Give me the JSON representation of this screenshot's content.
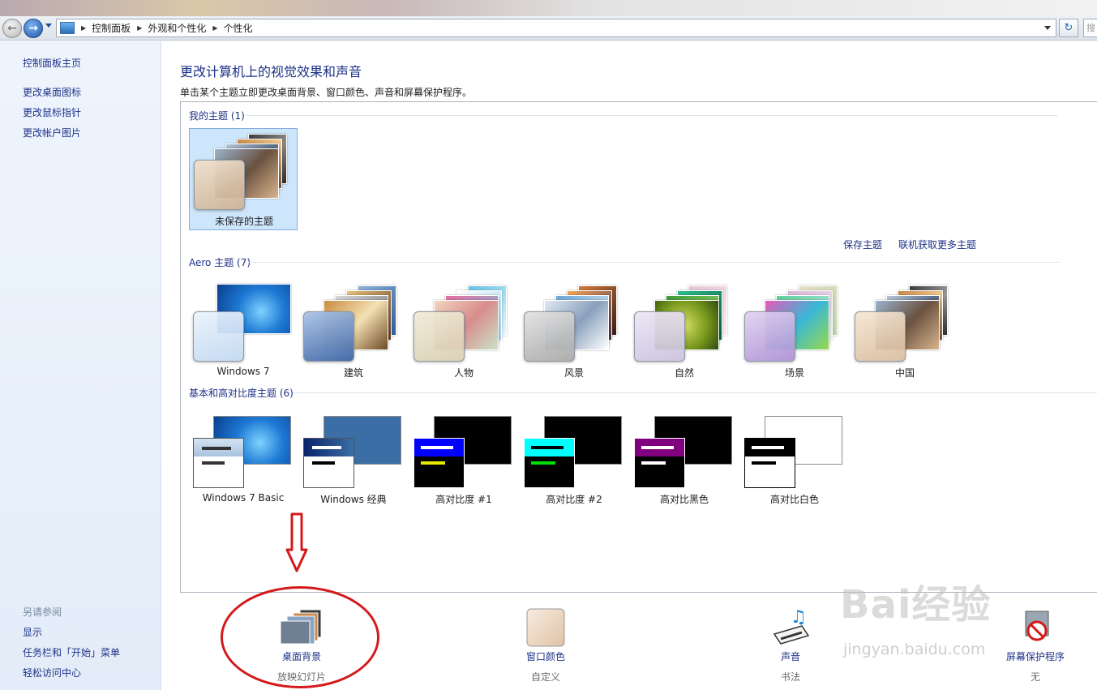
{
  "address_bar": {
    "breadcrumbs": [
      "控制面板",
      "外观和个性化",
      "个性化"
    ],
    "search_placeholder": "搜"
  },
  "sidebar": {
    "home_link": "控制面板主页",
    "links": [
      "更改桌面图标",
      "更改鼠标指针",
      "更改帐户图片"
    ],
    "see_also_heading": "另请参阅",
    "see_also_links": [
      "显示",
      "任务栏和「开始」菜单",
      "轻松访问中心"
    ]
  },
  "main": {
    "title": "更改计算机上的视觉效果和声音",
    "description": "单击某个主题立即更改桌面背景、窗口颜色、声音和屏幕保护程序。",
    "my_themes": {
      "label": "我的主题 (1)",
      "items": [
        {
          "name": "未保存的主题",
          "selected": true
        }
      ]
    },
    "actions": {
      "save_theme": "保存主题",
      "get_more_online": "联机获取更多主题"
    },
    "aero_themes": {
      "label": "Aero 主题 (7)",
      "items": [
        "Windows 7",
        "建筑",
        "人物",
        "风景",
        "自然",
        "场景",
        "中国"
      ]
    },
    "basic_themes": {
      "label": "基本和高对比度主题 (6)",
      "items": [
        "Windows 7 Basic",
        "Windows 经典",
        "高对比度 #1",
        "高对比度 #2",
        "高对比黑色",
        "高对比白色"
      ]
    }
  },
  "bottom_bar": {
    "desktop_background": {
      "label": "桌面背景",
      "sub": "放映幻灯片"
    },
    "window_color": {
      "label": "窗口颜色",
      "sub": "自定义"
    },
    "sounds": {
      "label": "声音",
      "sub": "书法"
    },
    "screen_saver": {
      "label": "屏幕保护程序",
      "sub": "无"
    }
  },
  "watermark": {
    "main": "Bai经验",
    "sub": "jingyan.baidu.com"
  },
  "colors": {
    "link": "#1e3287",
    "annotation": "#d4191b",
    "selection": "#cde6fb"
  }
}
